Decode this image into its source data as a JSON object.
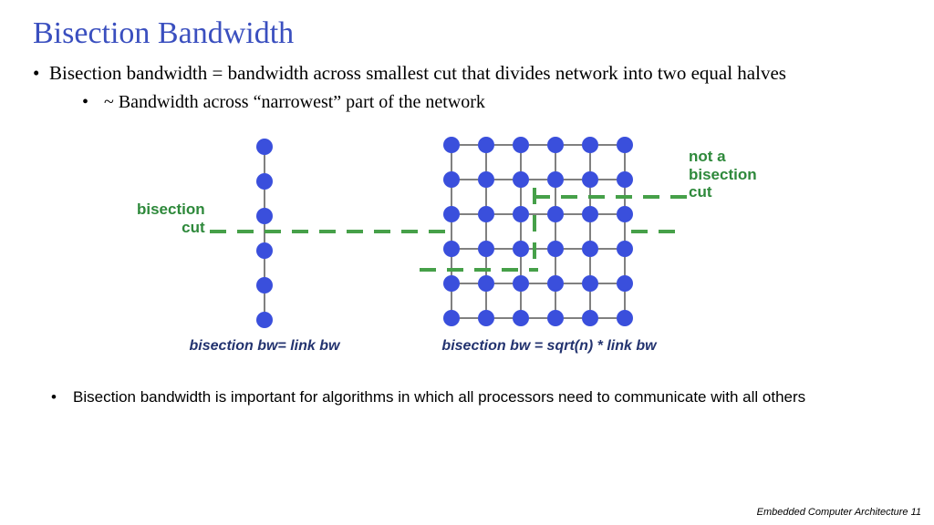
{
  "title": "Bisection Bandwidth",
  "b1": "Bisection bandwidth =  bandwidth across smallest cut that divides network into two equal halves",
  "b2": "~ Bandwidth across “narrowest” part of the network",
  "label_left": "bisection\ncut",
  "label_right": "not a\nbisection\ncut",
  "cap_left": "bisection bw= link bw",
  "cap_right": "bisection bw = sqrt(n) * link bw",
  "note": "Bisection bandwidth is important for algorithms in which all processors need to communicate with all others",
  "footer": "Embedded Computer Architecture  11",
  "chart_data": [
    {
      "type": "diagram",
      "name": "linear-array",
      "nodes": 6,
      "topology": "1D linear chain",
      "bisection_cut_links": 1,
      "caption": "bisection bw= link bw"
    },
    {
      "type": "diagram",
      "name": "mesh",
      "rows": 6,
      "cols": 6,
      "topology": "2D mesh",
      "bisection_cut_links": "sqrt(n)",
      "caption": "bisection bw = sqrt(n) * link bw",
      "non_bisection_cut": "partial L-cut top-right"
    }
  ]
}
